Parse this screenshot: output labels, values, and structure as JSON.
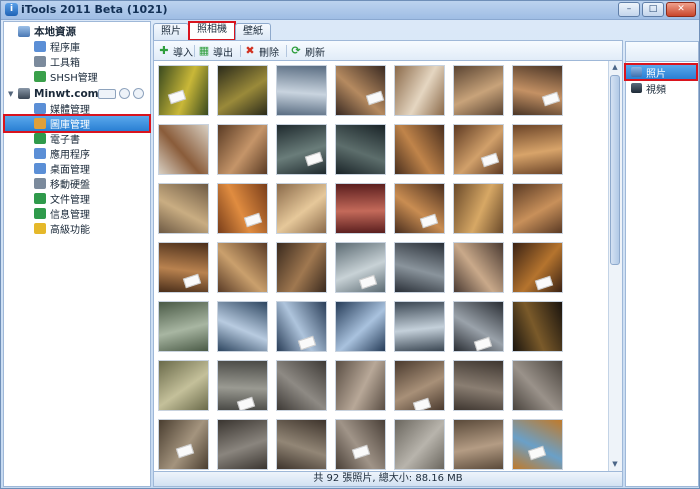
{
  "window": {
    "title": "iTools 2011 Beta (1021)",
    "controls": {
      "minimize": "–",
      "maximize": "□",
      "close": "✕"
    }
  },
  "sidebar": {
    "groups": [
      {
        "label": "本地資源",
        "icon": "computer-icon",
        "items": [
          {
            "label": "程序庫",
            "icon": "library-icon",
            "color": "#5b8fd6"
          },
          {
            "label": "工具箱",
            "icon": "toolbox-icon",
            "color": "#7b8a9c"
          },
          {
            "label": "SHSH管理",
            "icon": "shsh-icon",
            "color": "#3aa04a"
          }
        ]
      },
      {
        "label": "Minwt.com",
        "icon": "iphone-icon",
        "items": [
          {
            "label": "媒體管理",
            "icon": "media-icon",
            "color": "#5b8fd6"
          },
          {
            "label": "圖庫管理",
            "icon": "gallery-icon",
            "color": "#e0a03a",
            "selected": true,
            "highlighted": true
          },
          {
            "label": "電子書",
            "icon": "ebook-icon",
            "color": "#2f9a4b"
          },
          {
            "label": "應用程序",
            "icon": "apps-icon",
            "color": "#5b8fd6"
          },
          {
            "label": "桌面管理",
            "icon": "desktop-icon",
            "color": "#5b8fd6"
          },
          {
            "label": "移動硬盤",
            "icon": "disk-icon",
            "color": "#7b8a9c"
          },
          {
            "label": "文件管理",
            "icon": "files-icon",
            "color": "#2f9a4b"
          },
          {
            "label": "信息管理",
            "icon": "contacts-icon",
            "color": "#2f9a4b"
          },
          {
            "label": "高級功能",
            "icon": "star-icon",
            "color": "#e5b82a"
          }
        ]
      }
    ]
  },
  "tabs": [
    {
      "label": "照片",
      "active": false
    },
    {
      "label": "照相機",
      "active": true,
      "highlighted": true
    },
    {
      "label": "壁紙",
      "active": false
    }
  ],
  "toolbar": [
    {
      "label": "導入",
      "icon": "import-icon",
      "glyph": "✚",
      "color": "#2e9e3c"
    },
    {
      "label": "導出",
      "icon": "export-icon",
      "glyph": "▦",
      "color": "#2e9e3c"
    },
    {
      "label": "刪除",
      "icon": "delete-icon",
      "glyph": "✖",
      "color": "#d1301f"
    },
    {
      "label": "刷新",
      "icon": "refresh-icon",
      "glyph": "⟳",
      "color": "#2e9e3c"
    }
  ],
  "gallery": {
    "photos": [
      {
        "c1": "#3a4a1f",
        "c2": "#c9b838"
      },
      {
        "c1": "#2b2b1a",
        "c2": "#9a8a3a"
      },
      {
        "c1": "#5a6d82",
        "c2": "#c9d4df"
      },
      {
        "c1": "#3a2a22",
        "c2": "#b58a60"
      },
      {
        "c1": "#8b6a4a",
        "c2": "#e5d6c1"
      },
      {
        "c1": "#5a4432",
        "c2": "#c8a37a"
      },
      {
        "c1": "#4a3526",
        "c2": "#c49164"
      },
      {
        "c1": "#d8cfc2",
        "c2": "#8a5c3a"
      },
      {
        "c1": "#5a3b24",
        "c2": "#c59569"
      },
      {
        "c1": "#1f2a2e",
        "c2": "#6a7d7a"
      },
      {
        "c1": "#1a2428",
        "c2": "#5d6e6c"
      },
      {
        "c1": "#4a2f1e",
        "c2": "#c0844a"
      },
      {
        "c1": "#5e3a22",
        "c2": "#d1a06a"
      },
      {
        "c1": "#6b4428",
        "c2": "#d8a46a"
      },
      {
        "c1": "#6e5a44",
        "c2": "#c9ad82"
      },
      {
        "c1": "#7a3e1a",
        "c2": "#e08c40"
      },
      {
        "c1": "#8a6a4a",
        "c2": "#e6c89a"
      },
      {
        "c1": "#5a1e1e",
        "c2": "#c46a5a"
      },
      {
        "c1": "#4a2e1e",
        "c2": "#c98d52"
      },
      {
        "c1": "#6a4a2a",
        "c2": "#d7a865"
      },
      {
        "c1": "#5a3a24",
        "c2": "#c8905a"
      },
      {
        "c1": "#4a2e1a",
        "c2": "#b9824f"
      },
      {
        "c1": "#5a3b26",
        "c2": "#caa06d"
      },
      {
        "c1": "#3a2a1e",
        "c2": "#a07850"
      },
      {
        "c1": "#5b6a72",
        "c2": "#c8d2d6"
      },
      {
        "c1": "#2a3038",
        "c2": "#8a949c"
      },
      {
        "c1": "#4a3a32",
        "c2": "#c9a98a"
      },
      {
        "c1": "#3a2214",
        "c2": "#b5742e"
      },
      {
        "c1": "#4a5a46",
        "c2": "#a8b6a2"
      },
      {
        "c1": "#2e4660",
        "c2": "#b8cbe0"
      },
      {
        "c1": "#2a3e58",
        "c2": "#aec4dc"
      },
      {
        "c1": "#263c58",
        "c2": "#a9c2de"
      },
      {
        "c1": "#3a4652",
        "c2": "#c4d0da"
      },
      {
        "c1": "#2a2e34",
        "c2": "#9aa2aa"
      },
      {
        "c1": "#1a140e",
        "c2": "#7a5a2a"
      },
      {
        "c1": "#6a6a4a",
        "c2": "#c4c09a"
      },
      {
        "c1": "#4a4a46",
        "c2": "#9a9a92"
      },
      {
        "c1": "#3e3a36",
        "c2": "#8e8a84"
      },
      {
        "c1": "#5a4e44",
        "c2": "#b8a898"
      },
      {
        "c1": "#4a3a2e",
        "c2": "#a89078"
      },
      {
        "c1": "#3e3630",
        "c2": "#8a7e72"
      },
      {
        "c1": "#4a443e",
        "c2": "#9a928a"
      },
      {
        "c1": "#4a3e30",
        "c2": "#a4947e"
      },
      {
        "c1": "#3a3530",
        "c2": "#8a857e"
      },
      {
        "c1": "#3e342c",
        "c2": "#928676"
      },
      {
        "c1": "#4a4038",
        "c2": "#a09488"
      },
      {
        "c1": "#6a665e",
        "c2": "#b8b4ac"
      },
      {
        "c1": "#5a4a3a",
        "c2": "#b49c84"
      },
      {
        "c1": "#c07a2a",
        "c2": "#6aa0c8"
      }
    ]
  },
  "status": "共 92 張照片, 總大小: 88.16 MB",
  "rightpanel": {
    "items": [
      {
        "label": "照片",
        "icon": "photo-icon",
        "selected": true,
        "highlighted": true
      },
      {
        "label": "視頻",
        "icon": "video-icon",
        "selected": false
      }
    ]
  },
  "colors": {
    "accent": "#2a7fd3",
    "highlight": "#d9141e"
  }
}
